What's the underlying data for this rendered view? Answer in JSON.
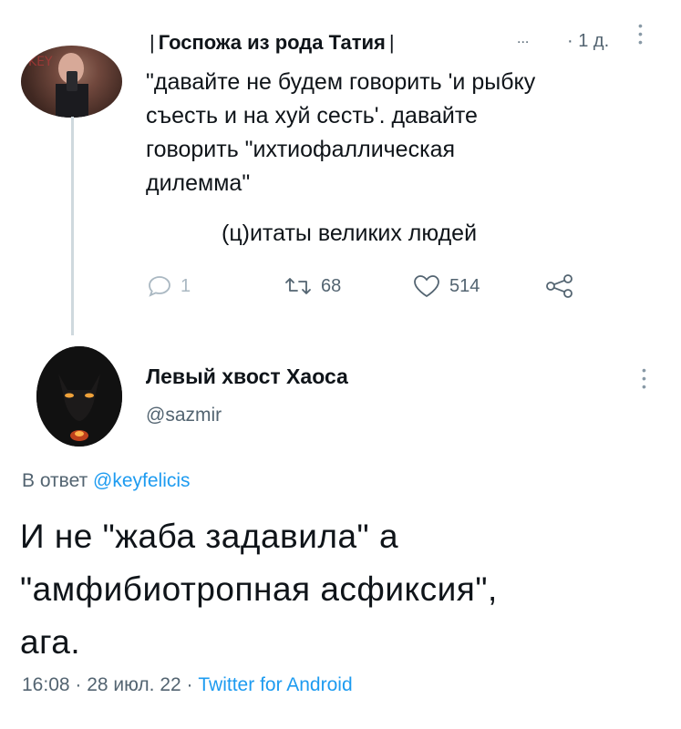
{
  "parent_tweet": {
    "author_name": "Госпожа из рода Татия",
    "separator": "|",
    "ellipsis": "...",
    "time_ago": "· 1 д.",
    "text_lines": "\"давайте не будем говорить 'и рыбку\nсъесть и на хуй сесть'. давайте\nговорить \"ихтиофаллическая\nдилемма\"",
    "quote_line": "(ц)итаты великих людей",
    "reply_count": "1",
    "retweet_count": "68",
    "like_count": "514"
  },
  "main_tweet": {
    "author_name": "Левый хвост Хаоса",
    "handle": "@sazmir",
    "reply_prefix": "В ответ",
    "reply_handle": "@keyfelicis",
    "text": "И не \"жаба задавила\" а\n\"амфибиотропная асфиксия\",\nага.",
    "time": "16:08 · 28 июл. 22 ·",
    "app": "Twitter for Android"
  },
  "icons": {
    "reply": "reply-icon",
    "retweet": "retweet-icon",
    "like": "heart-icon",
    "share": "share-icon",
    "more": "more-vertical-icon"
  },
  "colors": {
    "link": "#1d9bf0",
    "secondary_text": "#536471",
    "primary_text": "#0f1419"
  }
}
